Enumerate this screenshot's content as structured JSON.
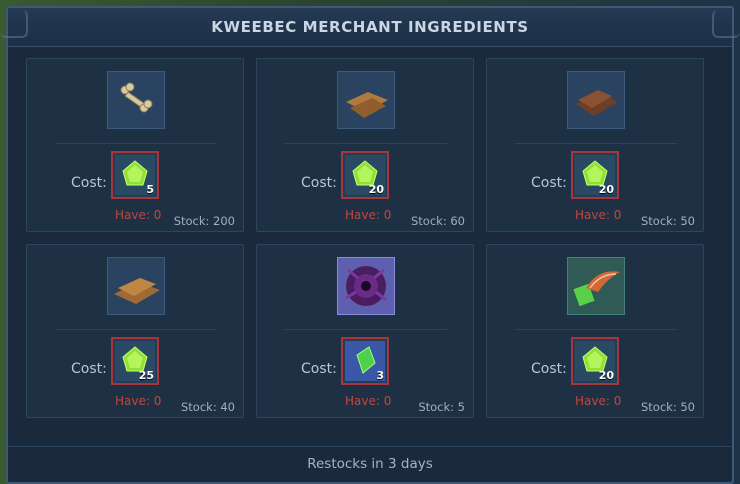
{
  "title": "KWEEBEC MERCHANT INGREDIENTS",
  "footer": "Restocks in 3 days",
  "cost_label": "Cost:",
  "items": [
    {
      "icon": "bone-icon",
      "cost_qty": "5",
      "have": "Have: 0",
      "stock": "Stock: 200",
      "slot": "default",
      "cost_slot": "green"
    },
    {
      "icon": "wood-planks-icon",
      "cost_qty": "20",
      "have": "Have: 0",
      "stock": "Stock: 60",
      "slot": "default",
      "cost_slot": "green"
    },
    {
      "icon": "dark-wood-planks-icon",
      "cost_qty": "20",
      "have": "Have: 0",
      "stock": "Stock: 50",
      "slot": "default",
      "cost_slot": "green"
    },
    {
      "icon": "wood-boards-icon",
      "cost_qty": "25",
      "have": "Have: 0",
      "stock": "Stock: 40",
      "slot": "default",
      "cost_slot": "green"
    },
    {
      "icon": "void-essence-icon",
      "cost_qty": "3",
      "have": "Have: 0",
      "stock": "Stock: 5",
      "slot": "purple",
      "cost_slot": "blue"
    },
    {
      "icon": "feather-quill-icon",
      "cost_qty": "20",
      "have": "Have: 0",
      "stock": "Stock: 50",
      "slot": "green",
      "cost_slot": "green"
    }
  ]
}
